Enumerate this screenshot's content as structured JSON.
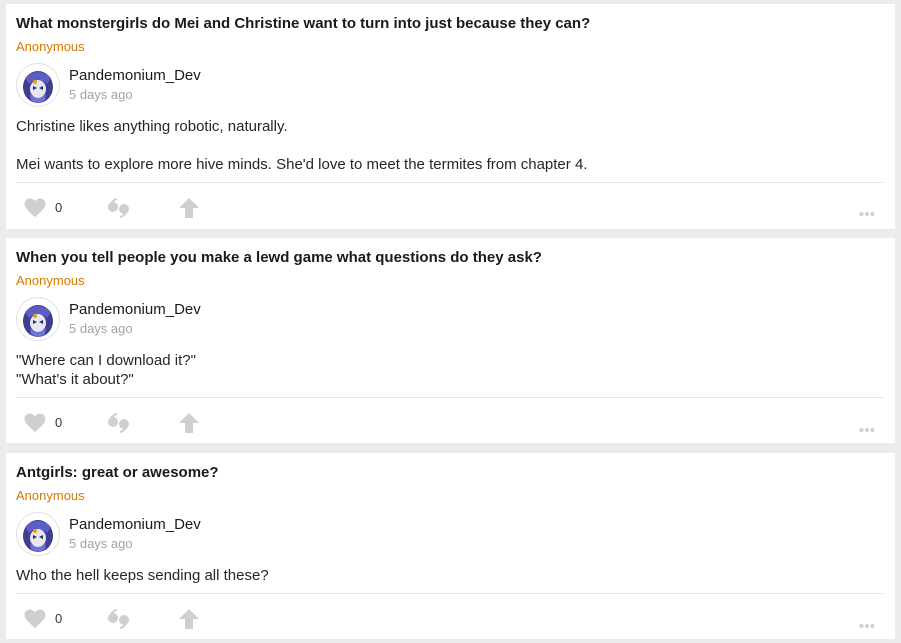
{
  "colors": {
    "page_bg": "#ececec",
    "card_bg": "#ffffff",
    "asker": "#d67a00",
    "muted_icon": "#cfcfcf",
    "time": "#a3a3a3"
  },
  "posts": [
    {
      "question": "What monstergirls do Mei and Christine want to turn into just because they can?",
      "asker": "Anonymous",
      "author": "Pandemonium_Dev",
      "time": "5 days ago",
      "answer_lines": [
        "Christine likes anything robotic, naturally.",
        "Mei wants to explore more hive minds. She'd love to meet the termites from chapter 4."
      ],
      "likes": "0",
      "icons": {
        "like": "heart-icon",
        "reply": "quote-icon",
        "share": "arrow-up-icon",
        "more": "more-dots-icon"
      }
    },
    {
      "question": "When you tell people you make a lewd game what questions do they ask?",
      "asker": "Anonymous",
      "author": "Pandemonium_Dev",
      "time": "5 days ago",
      "answer_lines": [
        "\"Where can I download it?\"",
        "\"What's it about?\""
      ],
      "likes": "0",
      "icons": {
        "like": "heart-icon",
        "reply": "quote-icon",
        "share": "arrow-up-icon",
        "more": "more-dots-icon"
      }
    },
    {
      "question": "Antgirls: great or awesome?",
      "asker": "Anonymous",
      "author": "Pandemonium_Dev",
      "time": "5 days ago",
      "answer_lines": [
        "Who the hell keeps sending all these?"
      ],
      "likes": "0",
      "icons": {
        "like": "heart-icon",
        "reply": "quote-icon",
        "share": "arrow-up-icon",
        "more": "more-dots-icon"
      }
    }
  ]
}
